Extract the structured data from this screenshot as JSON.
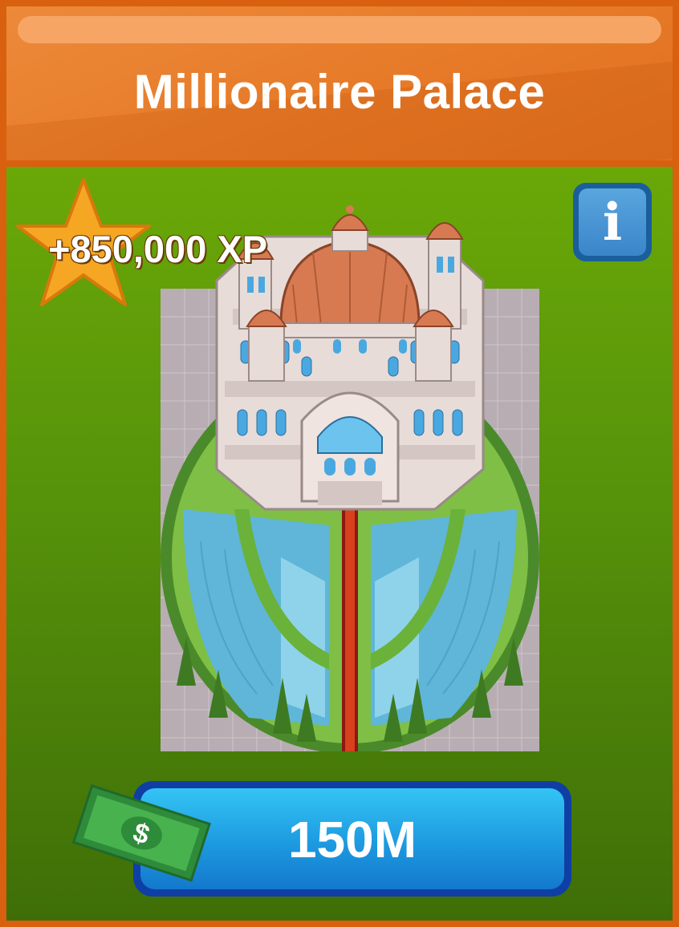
{
  "building": {
    "title": "Millionaire Palace",
    "xp_reward": "+850,000 XP",
    "price": "150M",
    "currency_symbol": "$"
  },
  "icons": {
    "info": "info-icon",
    "star": "xp-star-icon",
    "cash": "cash-bill-icon"
  },
  "colors": {
    "header_orange": "#e67a28",
    "panel_green": "#56920a",
    "button_blue": "#1d9ae0",
    "star_orange": "#f5a623"
  }
}
